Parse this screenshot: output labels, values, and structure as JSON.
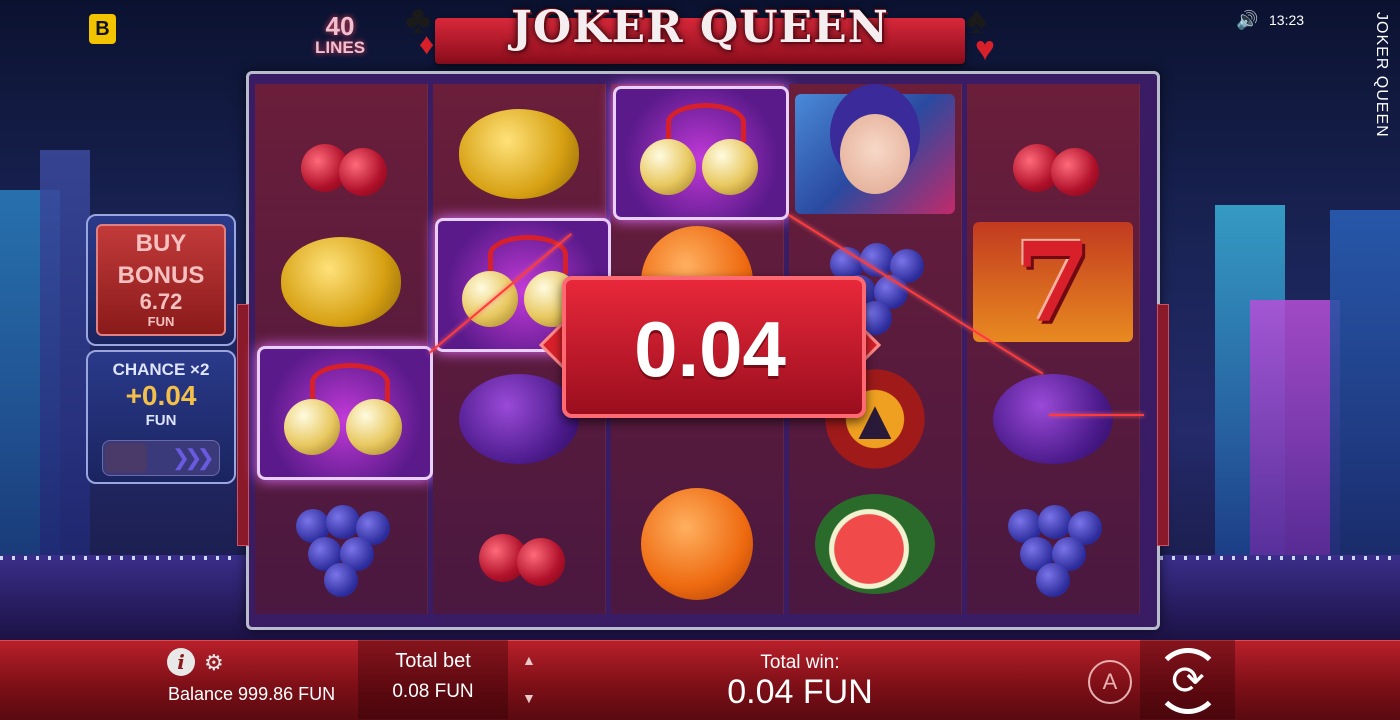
{
  "header": {
    "brand_letter": "B",
    "lines_count": "40",
    "lines_label": "LINES",
    "game_title": "JOKER QUEEN",
    "time": "13:23",
    "side_title": "JOKER QUEEN",
    "sound_icon": "speaker-icon"
  },
  "reels": [
    [
      "cherry",
      "lemon",
      "bells",
      "grapes"
    ],
    [
      "lemon",
      "bells",
      "plum",
      "cherry"
    ],
    [
      "bells",
      "orange",
      "lucky",
      "orange"
    ],
    [
      "joker",
      "grapes",
      "bat",
      "watermelon"
    ],
    [
      "cherry",
      "seven",
      "plum",
      "grapes"
    ]
  ],
  "win": {
    "amount": "0.04"
  },
  "buy_bonus": {
    "line1": "BUY",
    "line2": "BONUS",
    "amount": "6.72",
    "currency": "FUN"
  },
  "chance": {
    "label": "CHANCE ×2",
    "amount": "+0.04",
    "currency": "FUN"
  },
  "bottom": {
    "balance": "Balance 999.86 FUN",
    "total_bet_label": "Total bet",
    "total_bet_value": "0.08 FUN",
    "total_win_label": "Total win:",
    "total_win_value": "0.04 FUN",
    "auto_label": "A"
  },
  "colors": {
    "accent": "#d8202a",
    "gold": "#f2c04a",
    "brand": "#f2c400"
  }
}
